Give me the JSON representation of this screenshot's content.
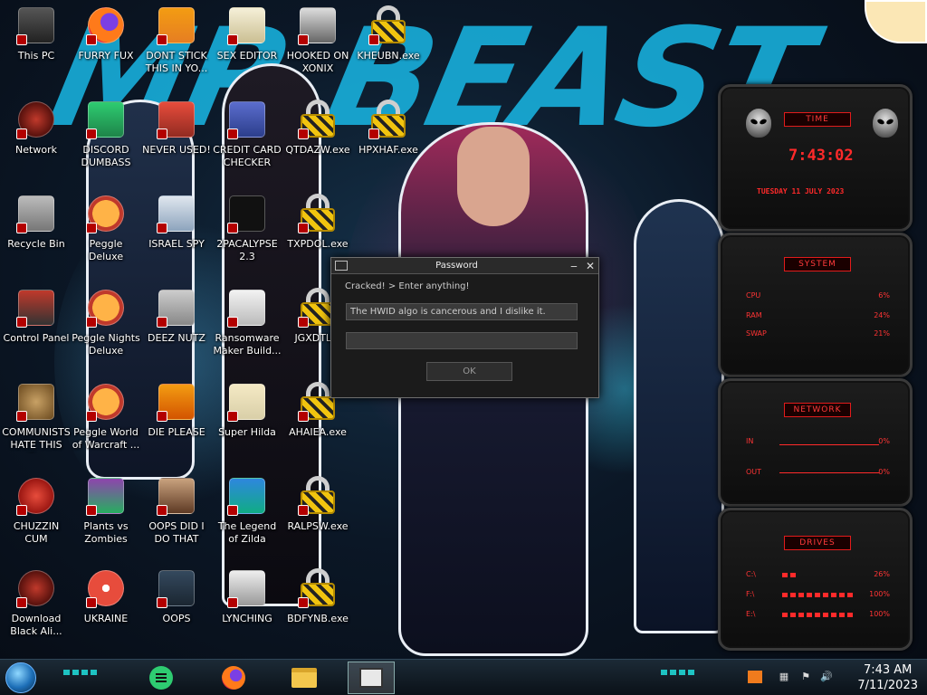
{
  "desktop_icons": [
    {
      "label": "This PC",
      "icon": "this-pc-icon"
    },
    {
      "label": "FURRY FUX",
      "icon": "firefox-icon"
    },
    {
      "label": "DONT STICK THIS IN YO...",
      "icon": "vlc-icon"
    },
    {
      "label": "SEX EDITOR",
      "icon": "hex-editor-icon"
    },
    {
      "label": "HOOKED ON XONIX",
      "icon": "xonix-game-icon"
    },
    {
      "label": "KHEUBN.exe",
      "icon": "lock-icon"
    },
    {
      "label": "Network",
      "icon": "network-icon"
    },
    {
      "label": "DISCORD DUMBASS",
      "icon": "chat-icon"
    },
    {
      "label": "NEVER USED!",
      "icon": "dev-cpp-icon"
    },
    {
      "label": "CREDIT CARD CHECKER",
      "icon": "credit-card-icon"
    },
    {
      "label": "QTDAZW.exe",
      "icon": "lock-icon"
    },
    {
      "label": "HPXHAF.exe",
      "icon": "lock-icon"
    },
    {
      "label": "Recycle Bin",
      "icon": "recycle-bin-icon"
    },
    {
      "label": "Peggle Deluxe",
      "icon": "peggle-icon"
    },
    {
      "label": "ISRAEL SPY",
      "icon": "spy-app-icon"
    },
    {
      "label": "2PACALYPSE 2.3",
      "icon": "terminal-icon"
    },
    {
      "label": "TXPDOL.exe",
      "icon": "lock-icon"
    },
    {
      "label": "Control Panel",
      "icon": "control-panel-icon"
    },
    {
      "label": "Peggle Nights Deluxe",
      "icon": "peggle-icon"
    },
    {
      "label": "DEEZ NUTZ",
      "icon": "windows-stack-icon"
    },
    {
      "label": "Ransomware Maker Build...",
      "icon": "ransomware-builder-icon"
    },
    {
      "label": "JGXDTL...",
      "icon": "lock-icon"
    },
    {
      "label": "COMMUNISTS HATE THIS G...",
      "icon": "money-bag-icon"
    },
    {
      "label": "Peggle World of Warcraft ...",
      "icon": "peggle-icon"
    },
    {
      "label": "DIE PLEASE",
      "icon": "de-app-icon"
    },
    {
      "label": "Super Hilda",
      "icon": "pixel-game-icon"
    },
    {
      "label": "AHAIEA.exe",
      "icon": "lock-icon"
    },
    {
      "label": "CHUZZIN CUM",
      "icon": "chuzzle-icon"
    },
    {
      "label": "Plants vs Zombies",
      "icon": "plants-vs-zombies-icon"
    },
    {
      "label": "OOPS DID I DO THAT",
      "icon": "portrait-icon"
    },
    {
      "label": "The Legend of Zilda",
      "icon": "zelda-icon"
    },
    {
      "label": "RALPSW.exe",
      "icon": "lock-icon"
    },
    {
      "label": "Download Black Ali...",
      "icon": "alienware-icon"
    },
    {
      "label": "UKRAINE",
      "icon": "radiation-icon"
    },
    {
      "label": "OOPS",
      "icon": "chalkboard-icon"
    },
    {
      "label": "LYNCHING",
      "icon": "tux-icon"
    },
    {
      "label": "BDFYNB.exe",
      "icon": "lock-icon"
    }
  ],
  "dialog": {
    "title": "Password",
    "minimize_label": "‒",
    "close_label": "✕",
    "prompt": "Cracked! > Enter anything!",
    "field_one_value": "The HWID algo is cancerous and I dislike it.",
    "field_two_value": "",
    "ok_label": "OK"
  },
  "gadgets": {
    "time": {
      "header": "TIME",
      "time": "7:43:02",
      "date": "TUESDAY 11 JULY 2023"
    },
    "system": {
      "header": "SYSTEM",
      "rows": [
        {
          "label": "CPU",
          "value": "6%"
        },
        {
          "label": "RAM",
          "value": "24%"
        },
        {
          "label": "SWAP",
          "value": "21%"
        }
      ]
    },
    "network": {
      "header": "NETWORK",
      "rows": [
        {
          "label": "IN",
          "value": "0%"
        },
        {
          "label": "OUT",
          "value": "0%"
        }
      ]
    },
    "drives": {
      "header": "DRIVES",
      "rows": [
        {
          "label": "C:\\",
          "value": "26%"
        },
        {
          "label": "F:\\",
          "value": "100%"
        },
        {
          "label": "E:\\",
          "value": "100%"
        }
      ]
    }
  },
  "wallpaper": {
    "lettering": "MR BEAST"
  },
  "taskbar": {
    "pinned": [
      {
        "name": "chat-app",
        "icon": "chat-icon"
      },
      {
        "name": "firefox",
        "icon": "firefox-icon"
      },
      {
        "name": "file-explorer",
        "icon": "folder-icon"
      },
      {
        "name": "password-app",
        "icon": "window-icon",
        "active": true
      }
    ],
    "tray_icons": [
      "network-icon",
      "flag-icon",
      "speaker-icon"
    ],
    "clock_time": "7:43 AM",
    "clock_date": "7/11/2023"
  },
  "colors": {
    "accent_red": "#ff2a2a",
    "accent_cyan": "#19b8e6",
    "dialog_bg": "#1b1b1b"
  }
}
